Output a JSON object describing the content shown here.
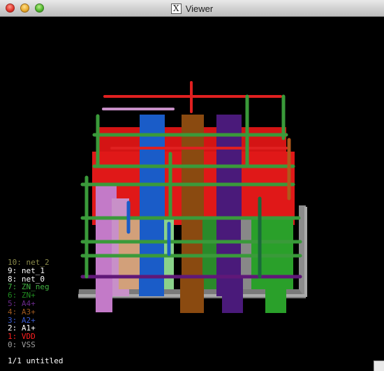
{
  "window": {
    "title": "Viewer"
  },
  "status": {
    "text": "1/1 untitled"
  },
  "legend": [
    {
      "label": "10: net_2",
      "color": "#8a8a4a"
    },
    {
      "label": "9: net_1",
      "color": "#ffffff"
    },
    {
      "label": "8: net_0",
      "color": "#ffffff"
    },
    {
      "label": "7: ZN_neg",
      "color": "#40b040"
    },
    {
      "label": "6: ZN+",
      "color": "#208a20"
    },
    {
      "label": "5: A4+",
      "color": "#6a2a8a"
    },
    {
      "label": "4: A3+",
      "color": "#a05a20"
    },
    {
      "label": "3: A2+",
      "color": "#3a5ad0"
    },
    {
      "label": "2: A1+",
      "color": "#ffffff"
    },
    {
      "label": "1: VDD",
      "color": "#ff2020"
    },
    {
      "label": "0: VSS",
      "color": "#a0a0a0"
    }
  ]
}
